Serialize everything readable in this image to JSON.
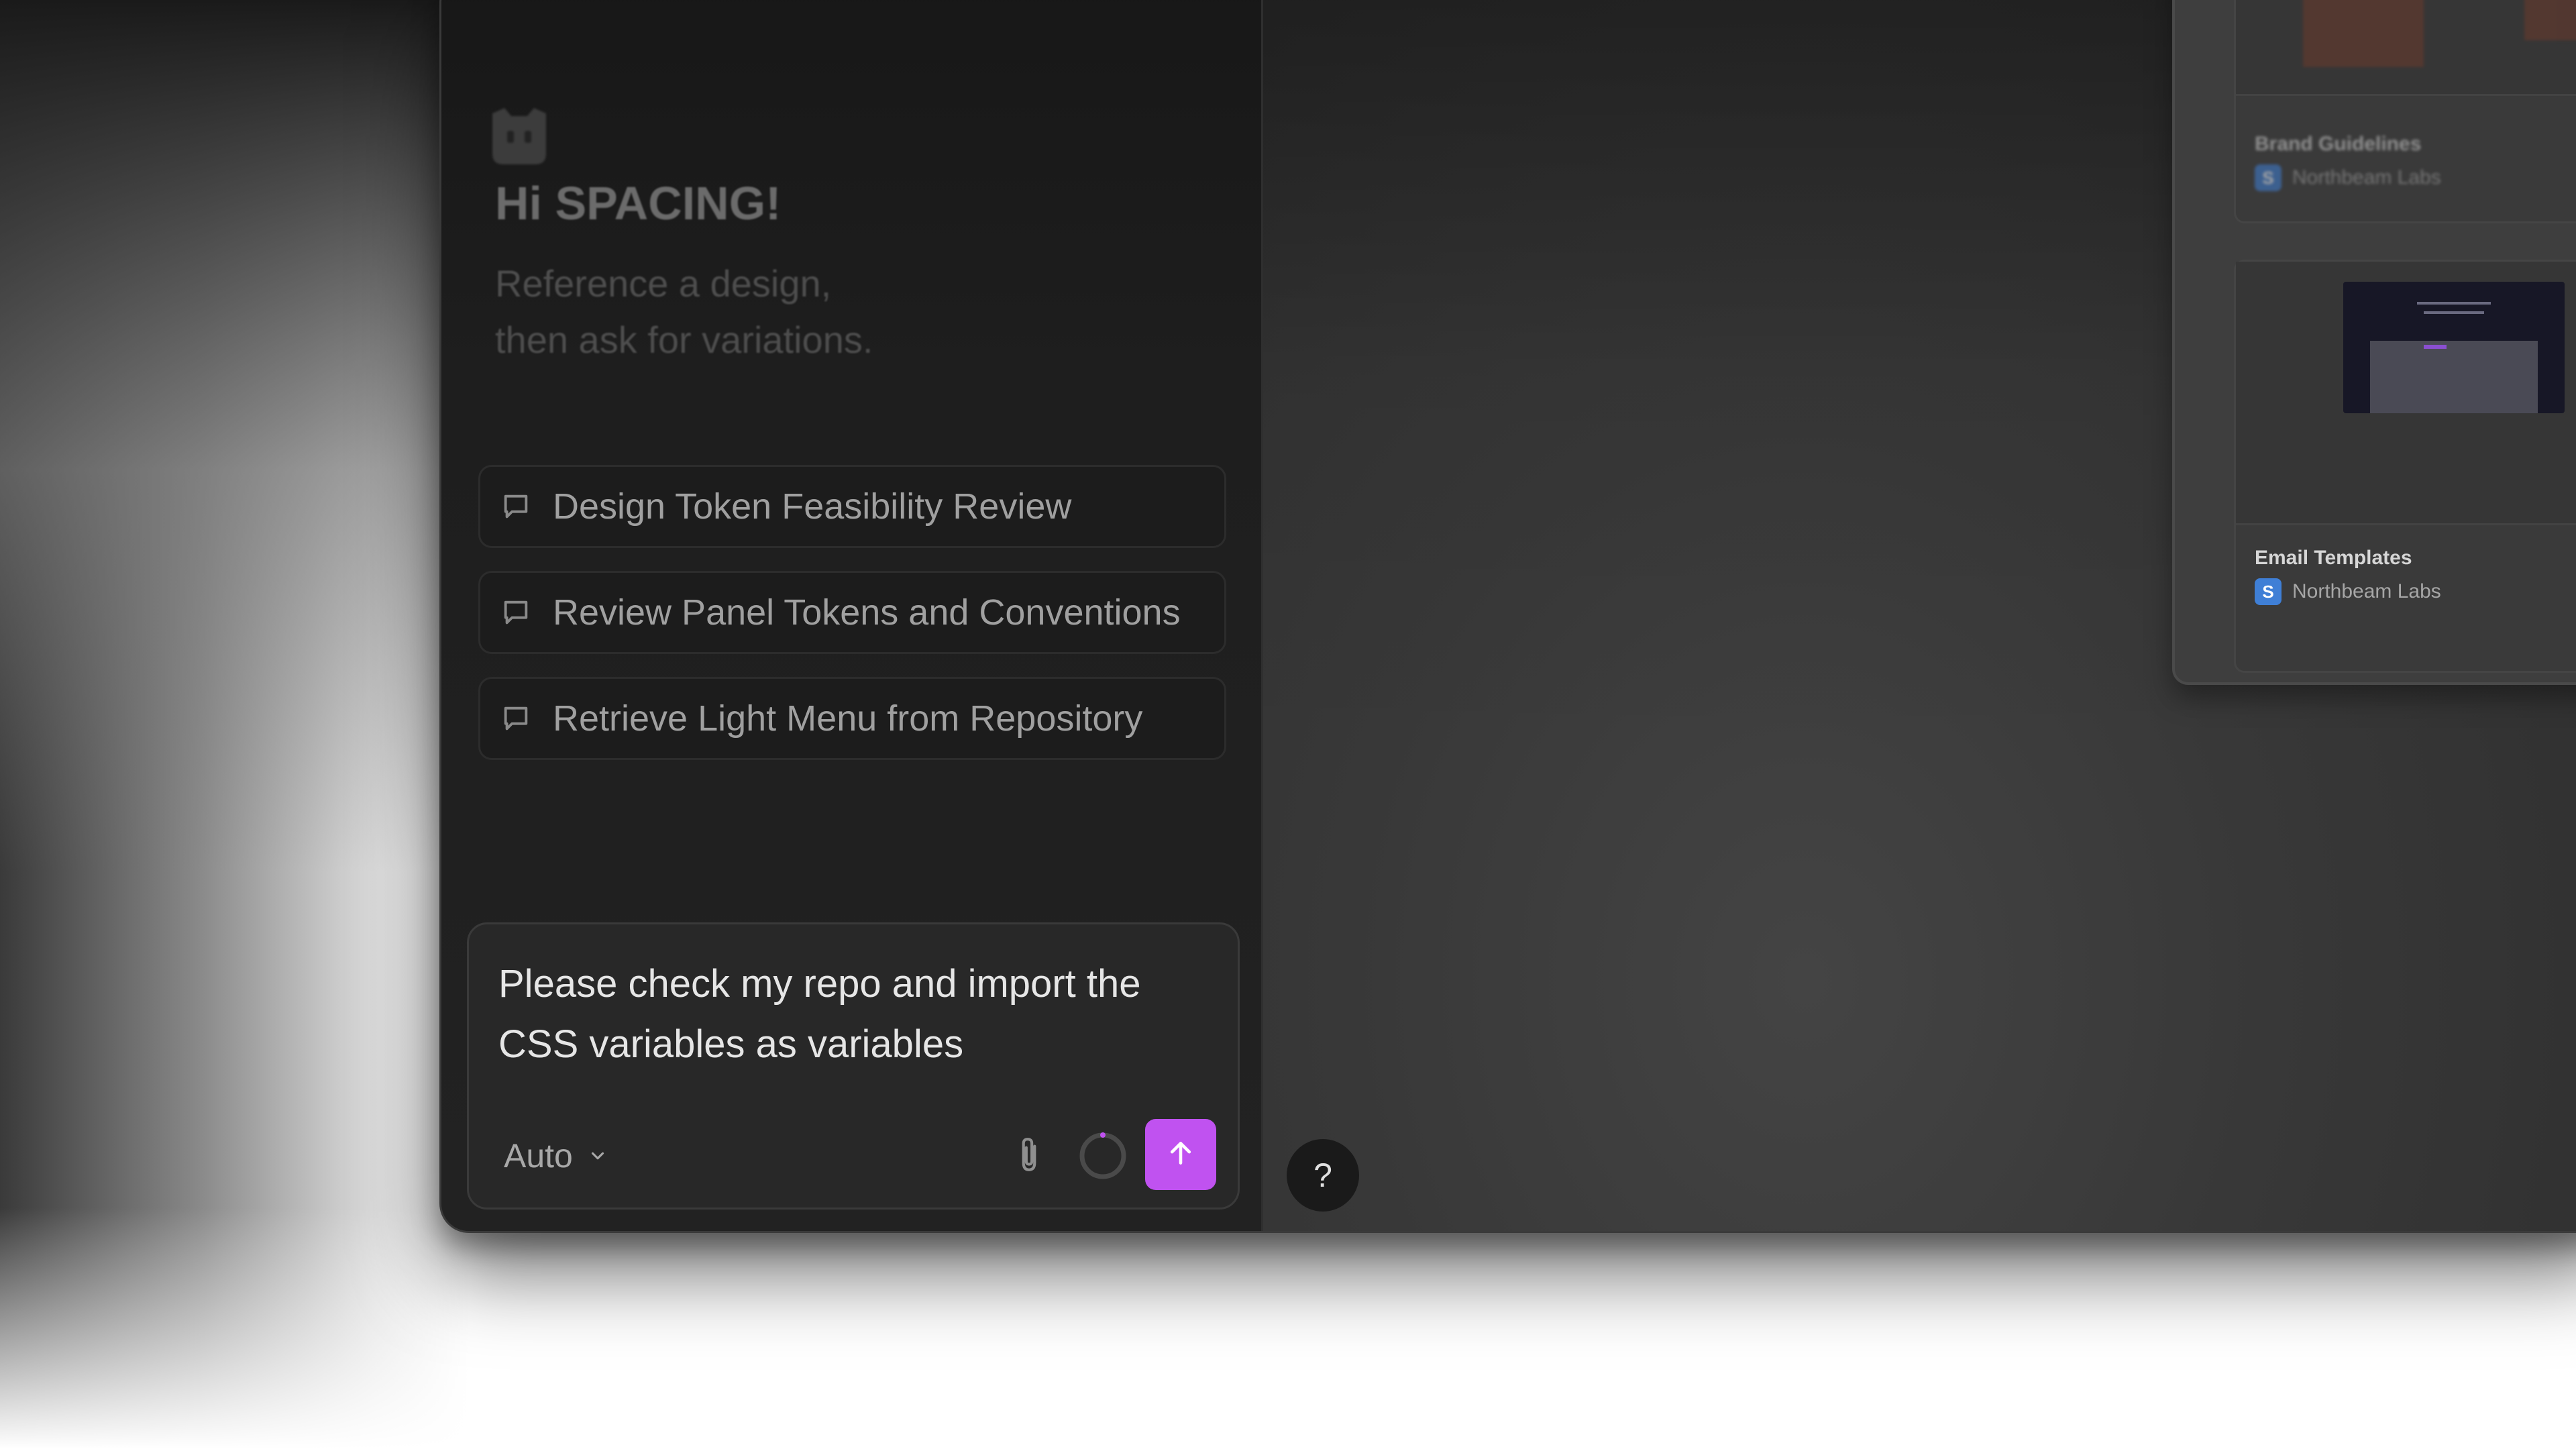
{
  "greeting": "Hi SPACING!",
  "subtitle": "Reference a design,\nthen ask for variations.",
  "history": [
    {
      "label": "Design Token Feasibility Review",
      "icon": "chat-bubble-icon"
    },
    {
      "label": "Review Panel Tokens and Conventions",
      "icon": "chat-bubble-icon"
    },
    {
      "label": "Retrieve Light Menu from Repository",
      "icon": "chat-bubble-icon"
    }
  ],
  "composer": {
    "text": "Please check my repo and import the CSS variables as variables",
    "model_label": "Auto",
    "attach_icon": "paperclip-icon",
    "progress_icon": "progress-ring-icon",
    "send_icon": "arrow-up-icon"
  },
  "help_label": "?",
  "files": [
    {
      "name": "Brand Guidelines",
      "owner": "Northbeam Labs"
    },
    {
      "name": "Email Templates",
      "owner": "Northbeam Labs"
    }
  ],
  "colors": {
    "accent": "#c052f0",
    "owner_badge": "#3f7fd6",
    "panel_bg": "#1e1e1e",
    "canvas_bg": "#383838"
  }
}
